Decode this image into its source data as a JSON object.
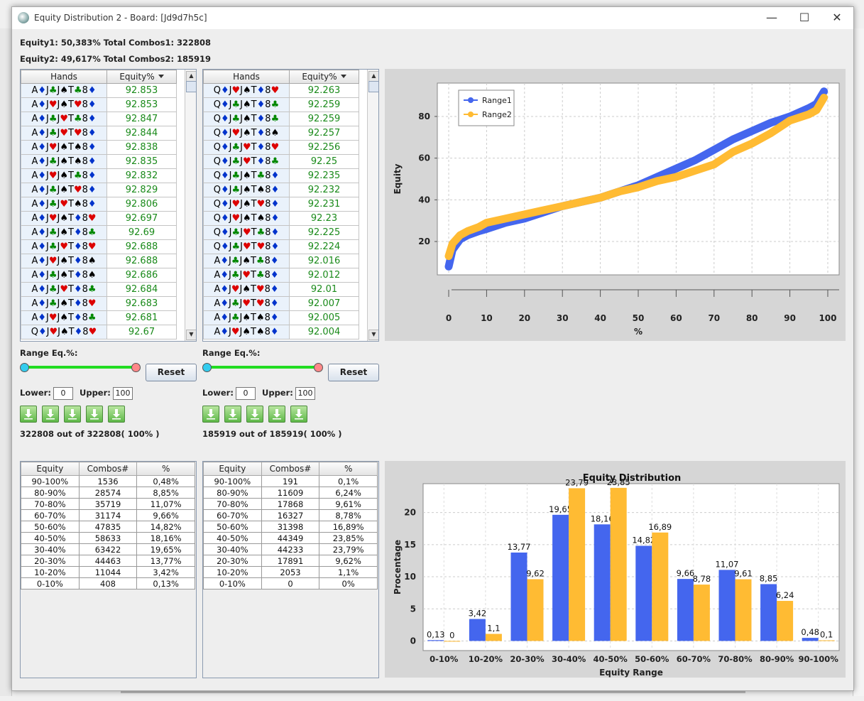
{
  "window": {
    "title": "Equity Distribution 2 - Board: [Jd9d7h5c]"
  },
  "summary": {
    "line1": "Equity1: 50,383%  Total Combos1: 322808",
    "line2": "Equity2: 49,617%  Total Combos2: 185919"
  },
  "colors": {
    "range1": "#4466ee",
    "range2": "#ffbb33",
    "equity_text": "#1a8a1a",
    "slider_track": "#22dd22",
    "heart_diamond": "#dd0000",
    "club": "#008800",
    "spade": "#000000",
    "diamond_blue": "#0033cc"
  },
  "hands_table_1": {
    "headers": [
      "Hands",
      "Equity%"
    ],
    "rows": [
      [
        "A♦J♣J♠T♣8♦",
        "92.853"
      ],
      [
        "A♦J♥J♠T♥8♦",
        "92.853"
      ],
      [
        "A♦J♣J♥T♣8♦",
        "92.847"
      ],
      [
        "A♦J♣J♥T♥8♦",
        "92.844"
      ],
      [
        "A♦J♥J♠T♠8♦",
        "92.838"
      ],
      [
        "A♦J♣J♠T♠8♦",
        "92.835"
      ],
      [
        "A♦J♥J♠T♣8♦",
        "92.832"
      ],
      [
        "A♦J♣J♠T♥8♦",
        "92.829"
      ],
      [
        "A♦J♣J♥T♠8♦",
        "92.806"
      ],
      [
        "A♦J♥J♠T♦8♥",
        "92.697"
      ],
      [
        "A♦J♣J♠T♦8♣",
        "92.69"
      ],
      [
        "A♦J♣J♥T♦8♥",
        "92.688"
      ],
      [
        "A♦J♥J♠T♦8♠",
        "92.688"
      ],
      [
        "A♦J♣J♠T♦8♠",
        "92.686"
      ],
      [
        "A♦J♣J♥T♦8♣",
        "92.684"
      ],
      [
        "A♦J♣J♠T♦8♥",
        "92.683"
      ],
      [
        "A♦J♥J♠T♦8♣",
        "92.681"
      ],
      [
        "Q♦J♥J♠T♦8♥",
        "92.67"
      ]
    ]
  },
  "hands_table_2": {
    "headers": [
      "Hands",
      "Equity%"
    ],
    "rows": [
      [
        "Q♦J♥J♠T♦8♥",
        "92.263"
      ],
      [
        "Q♦J♣J♠T♦8♣",
        "92.259"
      ],
      [
        "Q♦J♣J♠T♦8♣",
        "92.259"
      ],
      [
        "Q♦J♥J♠T♦8♠",
        "92.257"
      ],
      [
        "Q♦J♣J♥T♦8♥",
        "92.256"
      ],
      [
        "Q♦J♣J♥T♦8♣",
        "92.25"
      ],
      [
        "Q♦J♣J♠T♣8♦",
        "92.235"
      ],
      [
        "Q♦J♣J♠T♠8♦",
        "92.232"
      ],
      [
        "Q♦J♥J♠T♥8♦",
        "92.231"
      ],
      [
        "Q♦J♥J♠T♠8♦",
        "92.23"
      ],
      [
        "Q♦J♣J♥T♣8♦",
        "92.225"
      ],
      [
        "Q♦J♣J♥T♥8♦",
        "92.224"
      ],
      [
        "A♦J♣J♠T♣8♦",
        "92.016"
      ],
      [
        "A♦J♣J♥T♣8♦",
        "92.012"
      ],
      [
        "A♦J♥J♠T♥8♦",
        "92.01"
      ],
      [
        "A♦J♣J♥T♥8♦",
        "92.007"
      ],
      [
        "A♦J♣J♠T♠8♦",
        "92.005"
      ],
      [
        "A♦J♥J♠T♠8♦",
        "92.004"
      ]
    ]
  },
  "filter1": {
    "label": "Range Eq.%:",
    "reset": "Reset",
    "lower_label": "Lower:",
    "upper_label": "Upper:",
    "lower": "0",
    "upper": "100",
    "count_text": "322808 out of 322808( 100% )"
  },
  "filter2": {
    "label": "Range Eq.%:",
    "reset": "Reset",
    "lower_label": "Lower:",
    "upper_label": "Upper:",
    "lower": "0",
    "upper": "100",
    "count_text": "185919 out of 185919( 100% )"
  },
  "dist_table_1": {
    "headers": [
      "Equity",
      "Combos#",
      "%"
    ],
    "rows": [
      [
        "90-100%",
        "1536",
        "0,48%"
      ],
      [
        "80-90%",
        "28574",
        "8,85%"
      ],
      [
        "70-80%",
        "35719",
        "11,07%"
      ],
      [
        "60-70%",
        "31174",
        "9,66%"
      ],
      [
        "50-60%",
        "47835",
        "14,82%"
      ],
      [
        "40-50%",
        "58633",
        "18,16%"
      ],
      [
        "30-40%",
        "63422",
        "19,65%"
      ],
      [
        "20-30%",
        "44463",
        "13,77%"
      ],
      [
        "10-20%",
        "11044",
        "3,42%"
      ],
      [
        "0-10%",
        "408",
        "0,13%"
      ]
    ]
  },
  "dist_table_2": {
    "headers": [
      "Equity",
      "Combos#",
      "%"
    ],
    "rows": [
      [
        "90-100%",
        "191",
        "0,1%"
      ],
      [
        "80-90%",
        "11609",
        "6,24%"
      ],
      [
        "70-80%",
        "17868",
        "9,61%"
      ],
      [
        "60-70%",
        "16327",
        "8,78%"
      ],
      [
        "50-60%",
        "31398",
        "16,89%"
      ],
      [
        "40-50%",
        "44349",
        "23,85%"
      ],
      [
        "30-40%",
        "44233",
        "23,79%"
      ],
      [
        "20-30%",
        "17891",
        "9,62%"
      ],
      [
        "10-20%",
        "2053",
        "1,1%"
      ],
      [
        "0-10%",
        "0",
        "0%"
      ]
    ]
  },
  "chart_data": [
    {
      "type": "line",
      "xlabel": "%",
      "ylabel": "Equity",
      "xlim": [
        -3,
        103
      ],
      "ylim": [
        4,
        96
      ],
      "xticks": [
        0,
        10,
        20,
        30,
        40,
        50,
        60,
        70,
        80,
        90,
        100
      ],
      "yticks": [
        20,
        40,
        60,
        80
      ],
      "grid": true,
      "legend": "top-left",
      "series": [
        {
          "name": "Range1",
          "x": [
            0,
            1,
            3,
            5,
            8,
            10,
            15,
            20,
            25,
            30,
            35,
            40,
            45,
            50,
            55,
            60,
            65,
            70,
            75,
            80,
            85,
            90,
            95,
            97,
            99
          ],
          "y": [
            8,
            16,
            21,
            23,
            25,
            26,
            29,
            31,
            34,
            37,
            39,
            41,
            44,
            47,
            51,
            55,
            59,
            64,
            69,
            73,
            77,
            80,
            84,
            86,
            92
          ]
        },
        {
          "name": "Range2",
          "x": [
            0,
            1,
            3,
            5,
            8,
            10,
            15,
            20,
            25,
            30,
            35,
            40,
            45,
            50,
            55,
            60,
            65,
            70,
            75,
            80,
            85,
            90,
            95,
            97,
            99
          ],
          "y": [
            13,
            19,
            23,
            25,
            27,
            29,
            31,
            33,
            35,
            37,
            39,
            41,
            44,
            46,
            49,
            51,
            54,
            57,
            63,
            67,
            72,
            78,
            81,
            83,
            89
          ]
        }
      ]
    },
    {
      "type": "bar",
      "title": "Equity Distribution",
      "xlabel": "Equity Range",
      "ylabel": "Procentage",
      "ylim": [
        -1.5,
        24.5
      ],
      "yticks": [
        0,
        5,
        10,
        15,
        20
      ],
      "grid": true,
      "categories": [
        "0-10%",
        "10-20%",
        "20-30%",
        "30-40%",
        "40-50%",
        "50-60%",
        "60-70%",
        "70-80%",
        "80-90%",
        "90-100%"
      ],
      "series": [
        {
          "values": [
            0.13,
            3.42,
            13.77,
            19.65,
            18.16,
            14.82,
            9.66,
            11.07,
            8.85,
            0.48
          ],
          "labels": [
            "0,13",
            "3,42",
            "13,77",
            "19,65",
            "18,16",
            "14,82",
            "9,66",
            "11,07",
            "8,85",
            "0,48"
          ]
        },
        {
          "values": [
            0,
            1.1,
            9.62,
            23.79,
            23.85,
            16.89,
            8.78,
            9.61,
            6.24,
            0.1
          ],
          "labels": [
            "0",
            "1,1",
            "9,62",
            "23,79",
            "23,85",
            "16,89",
            "8,78",
            "9,61",
            "6,24",
            "0,1"
          ]
        }
      ]
    }
  ]
}
